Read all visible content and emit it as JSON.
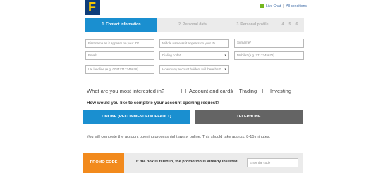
{
  "header": {
    "logo_letter": "F",
    "live_chat": "Live Chat",
    "separator": "|",
    "all_conditions": "All conditions"
  },
  "steps": [
    {
      "label": "1. Contact information",
      "active": true
    },
    {
      "label": "2. Personal data",
      "active": false
    },
    {
      "label": "3. Personal profile",
      "active": false
    },
    {
      "label": "4",
      "active": false
    },
    {
      "label": "5",
      "active": false
    },
    {
      "label": "6",
      "active": false
    }
  ],
  "form": {
    "first_name": {
      "placeholder": "First name as it appears on your ID*",
      "value": ""
    },
    "middle_name": {
      "placeholder": "Middle name as it appears on your ID",
      "value": ""
    },
    "surname": {
      "placeholder": "Surname*",
      "value": ""
    },
    "email": {
      "placeholder": "Email*",
      "value": ""
    },
    "dialing_code": {
      "selected": "Dialing code*"
    },
    "mobile": {
      "placeholder": "Mobile* (e.g. 7712345678)",
      "value": ""
    },
    "uk_landline": {
      "placeholder": "UK landline (e.g. 00447712345678)",
      "value": ""
    },
    "account_holders": {
      "selected": "How many account holders will there be?*"
    }
  },
  "interests": {
    "question": "What are you most interested in?",
    "options": [
      {
        "label": "Account and cards",
        "checked": false
      },
      {
        "label": "Trading",
        "checked": false
      },
      {
        "label": "Investing",
        "checked": false
      }
    ]
  },
  "completion": {
    "question": "How would you like to complete your account opening request?",
    "online_label": "ONLINE (RECOMMENDED/DEFAULT)",
    "telephone_label": "TELEPHONE",
    "online_color": "#1a8fd0",
    "telephone_color": "#646464",
    "info": "You will complete the account opening process right away, online. This should take approx. 8-15 minutes."
  },
  "promo": {
    "label": "PROMO CODE",
    "note": "If the box is filled in, the promotion is already inserted.",
    "input_placeholder": "Enter the code",
    "color": "#f28a1d"
  }
}
